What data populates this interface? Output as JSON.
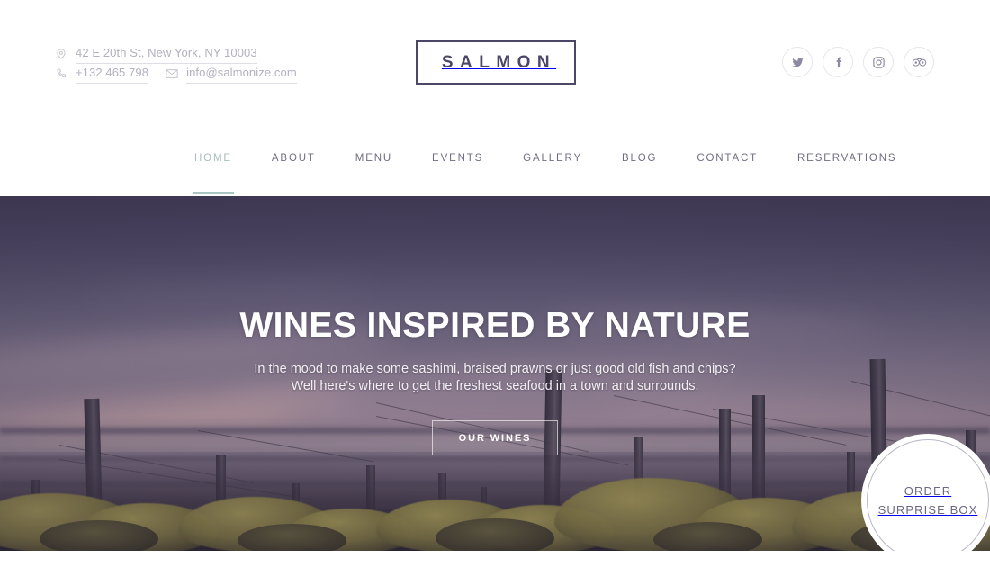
{
  "topbar": {
    "address": {
      "icon": "location-pin-icon",
      "text": "42 E 20th St, New York, NY 10003"
    },
    "phone": {
      "icon": "phone-icon",
      "text": "+132 465 798"
    },
    "email": {
      "icon": "envelope-icon",
      "text": "info@salmonize.com"
    },
    "logo": "SALMON",
    "social": [
      {
        "name": "twitter-icon",
        "label": "Twitter"
      },
      {
        "name": "facebook-icon",
        "label": "Facebook"
      },
      {
        "name": "instagram-icon",
        "label": "Instagram"
      },
      {
        "name": "tripadvisor-icon",
        "label": "TripAdvisor"
      }
    ]
  },
  "nav": {
    "items": [
      {
        "label": "HOME",
        "active": true
      },
      {
        "label": "ABOUT",
        "active": false
      },
      {
        "label": "MENU",
        "active": false
      },
      {
        "label": "EVENTS",
        "active": false
      },
      {
        "label": "GALLERY",
        "active": false
      },
      {
        "label": "BLOG",
        "active": false
      },
      {
        "label": "CONTACT",
        "active": false
      },
      {
        "label": "RESERVATIONS",
        "active": false
      }
    ],
    "active_color": "#a8bdba",
    "default_color": "#6f6d80"
  },
  "hero": {
    "title": "WINES INSPIRED BY NATURE",
    "subtitle_line1": "In the mood to make some sashimi, braised prawns or just good old fish and chips?",
    "subtitle_line2": "Well here's where to get the freshest seafood in a town and surrounds.",
    "cta_label": "OUR WINES",
    "badge_line1": "ORDER",
    "badge_line2": "SURPRISE BOX"
  },
  "colors": {
    "logo_border": "#4c4766",
    "logo_text": "#4c4766",
    "hero_sky_top": "#433c57",
    "hero_sky_bottom": "#9a8593",
    "badge_text": "#6c6881",
    "contact_text": "#b2b1bf"
  }
}
